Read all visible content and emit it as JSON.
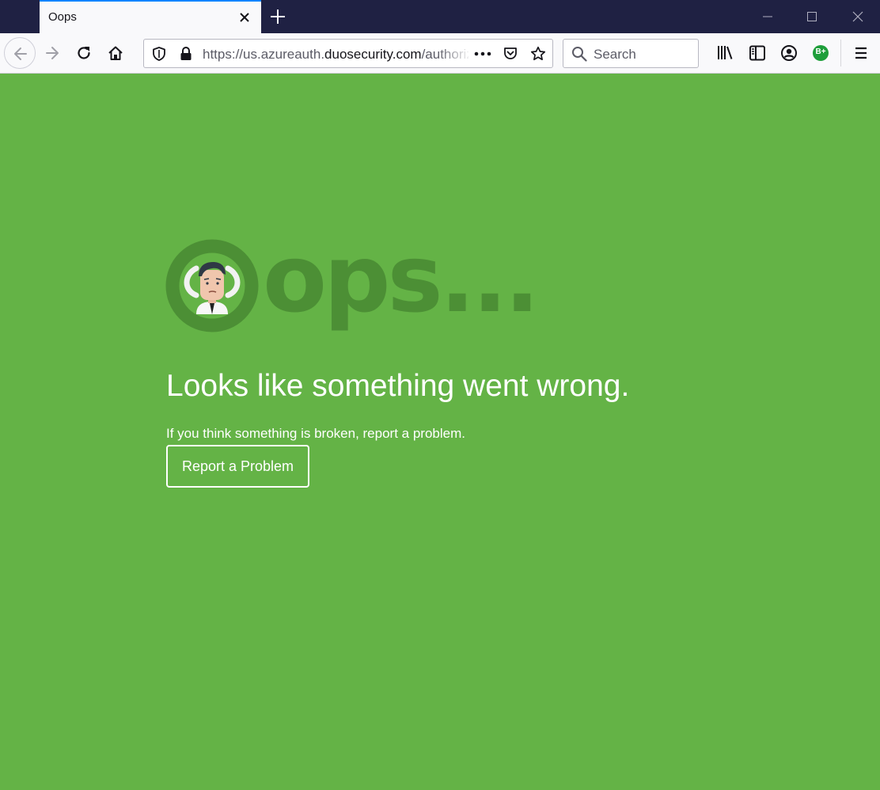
{
  "browser": {
    "tab": {
      "title": "Oops"
    },
    "url": {
      "prefix": "https://us.azureauth.",
      "domain": "duosecurity.com",
      "suffix": "/authorize"
    },
    "search": {
      "placeholder": "Search"
    },
    "extension_badge": "B+"
  },
  "page": {
    "background_color": "#64b346",
    "oops_word": "ops...",
    "headline": "Looks like something went wrong.",
    "subtext": "If you think something is broken, report a problem.",
    "report_button_label": "Report a Problem"
  }
}
